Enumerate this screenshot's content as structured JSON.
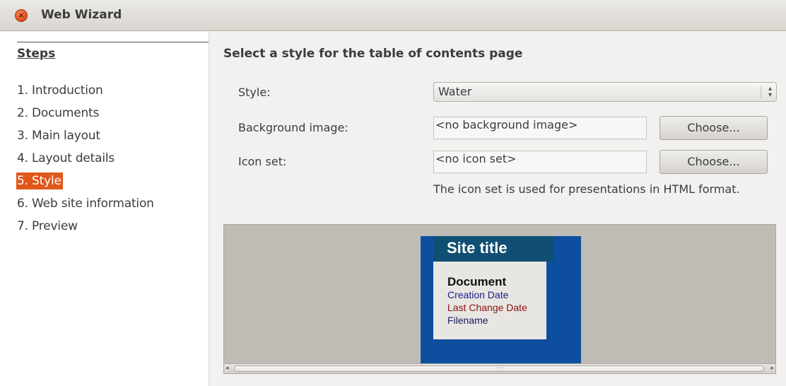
{
  "window": {
    "title": "Web Wizard"
  },
  "steps": {
    "title": "Steps",
    "items": [
      {
        "label": "1. Introduction",
        "active": false
      },
      {
        "label": "2. Documents",
        "active": false
      },
      {
        "label": "3. Main layout",
        "active": false
      },
      {
        "label": "4. Layout details",
        "active": false
      },
      {
        "label": "5. Style",
        "active": true
      },
      {
        "label": "6. Web site information",
        "active": false
      },
      {
        "label": "7. Preview",
        "active": false
      }
    ]
  },
  "main": {
    "section_title": "Select a style for the table of contents page",
    "style_label": "Style:",
    "style_value": "Water",
    "background_label": "Background image:",
    "background_value": "<no background image>",
    "background_button": "Choose...",
    "iconset_label": "Icon set:",
    "iconset_value": "<no icon set>",
    "iconset_button": "Choose...",
    "hint": "The icon set is used for presentations in HTML format."
  },
  "preview": {
    "site_title": "Site title",
    "document": "Document",
    "creation_date": "Creation Date",
    "last_change_date": "Last Change Date",
    "filename": "Filename"
  },
  "colors": {
    "accent": "#e0571a",
    "preview_bg": "#0d4f9e",
    "preview_header": "#104f73"
  }
}
